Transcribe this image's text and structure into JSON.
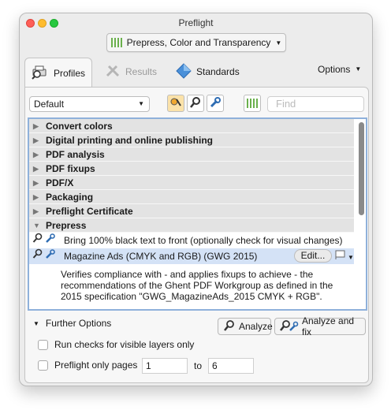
{
  "window": {
    "title": "Preflight"
  },
  "profile_selector": {
    "label": "Prepress, Color and Transparency"
  },
  "tabs": {
    "profiles": "Profiles",
    "results": "Results",
    "standards": "Standards",
    "options": "Options"
  },
  "toolbar": {
    "library": "Default",
    "find_placeholder": "Find"
  },
  "categories": [
    "Convert colors",
    "Digital printing and online publishing",
    "PDF analysis",
    "PDF fixups",
    "PDF/X",
    "Packaging",
    "Preflight Certificate",
    "Prepress"
  ],
  "profiles": [
    {
      "label": "Bring 100% black text to front (optionally check for visual changes)"
    },
    {
      "label": "Magazine Ads (CMYK and RGB) (GWG 2015)",
      "edit": "Edit..."
    }
  ],
  "description": "Verifies compliance with - and applies fixups to achieve - the recommendations of the Ghent PDF Workgroup as defined in the 2015 specification \"GWG_MagazineAds_2015 CMYK + RGB\".",
  "further_options": "Further Options",
  "buttons": {
    "analyze": "Analyze",
    "analyze_fix": "Analyze and fix"
  },
  "options": {
    "visible_layers": "Run checks for visible layers only",
    "only_pages": "Preflight only pages",
    "to": "to",
    "from_page": "1",
    "to_page": "6"
  },
  "colors": {
    "selection": "#d4e2f6",
    "list_border": "#8fb1db",
    "green_bars": "#6ab04c"
  }
}
